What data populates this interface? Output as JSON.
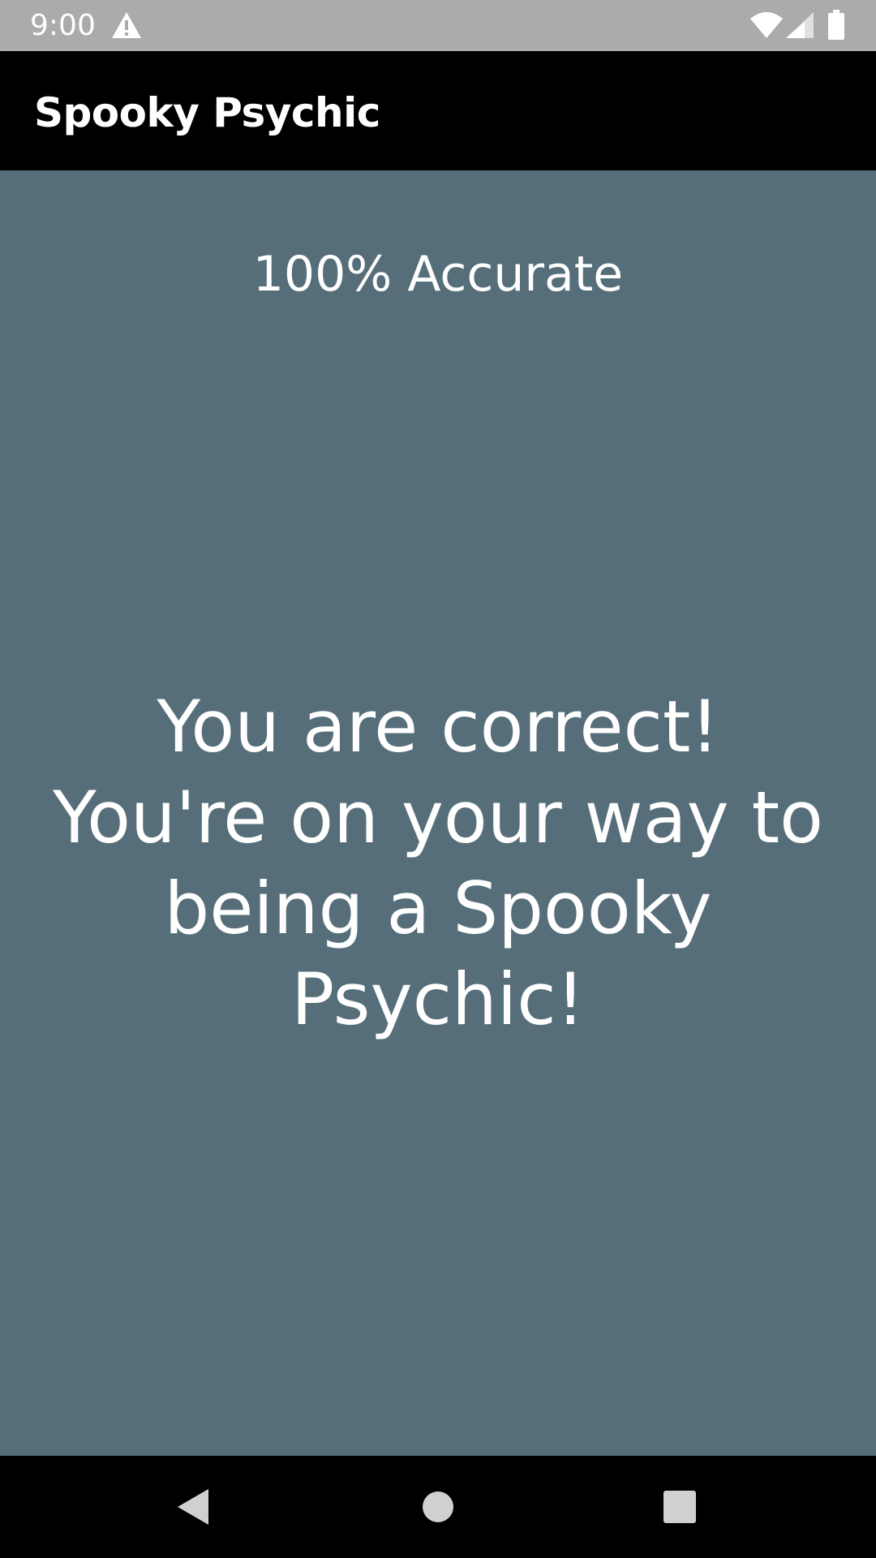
{
  "status_bar": {
    "time": "9:00",
    "icons": [
      "warning-icon",
      "wifi-icon",
      "cellular-signal-icon",
      "battery-icon"
    ]
  },
  "app_bar": {
    "title": "Spooky Psychic"
  },
  "main": {
    "accuracy": "100% Accurate",
    "message": "You are correct! You're on your way to being a Spooky Psychic!"
  },
  "nav_bar": {
    "icons": [
      "back-icon",
      "home-icon",
      "recents-icon"
    ]
  },
  "colors": {
    "status_bar_bg": "#ababab",
    "app_bar_bg": "#000000",
    "content_bg": "#566e79",
    "text": "#ffffff",
    "nav_icon": "#d0d0d0"
  }
}
